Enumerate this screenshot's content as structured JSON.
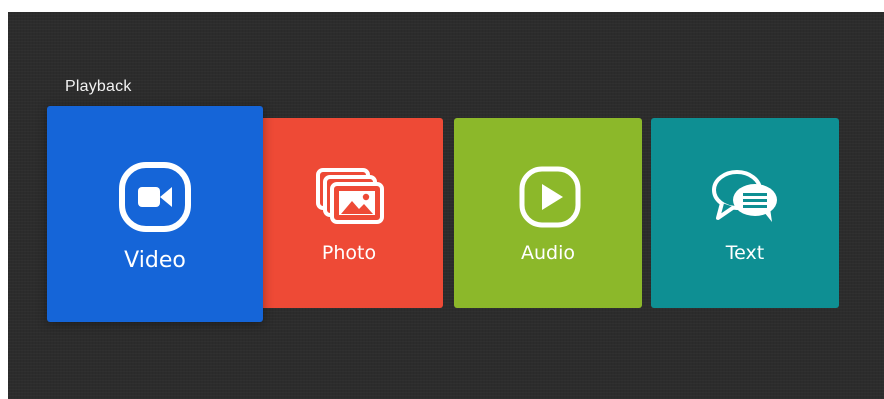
{
  "section": {
    "title": "Playback"
  },
  "tiles": [
    {
      "label": "Video",
      "icon": "video-camera-icon",
      "color": "#1565d8",
      "focused": true
    },
    {
      "label": "Photo",
      "icon": "photo-gallery-icon",
      "color": "#ee4a36",
      "focused": false
    },
    {
      "label": "Audio",
      "icon": "play-icon",
      "color": "#8cb82a",
      "focused": false
    },
    {
      "label": "Text",
      "icon": "chat-bubbles-icon",
      "color": "#0e8f93",
      "focused": false
    }
  ]
}
